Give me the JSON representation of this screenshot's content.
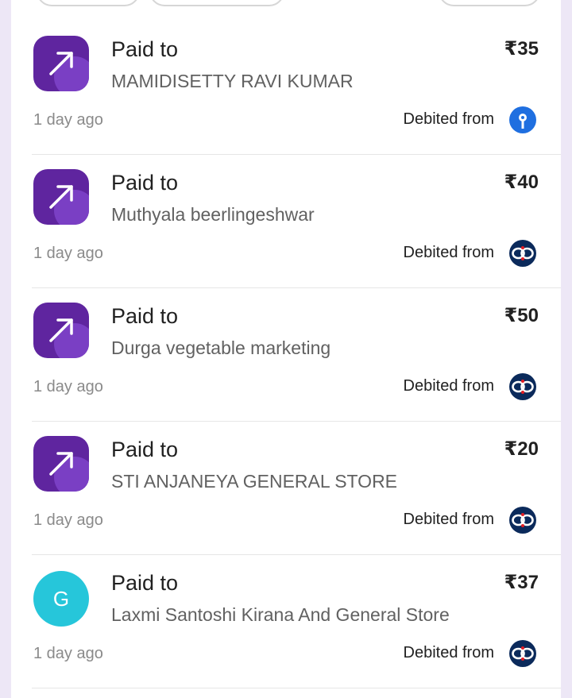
{
  "transactions": [
    {
      "type": "Paid to",
      "name": "MAMIDISETTY RAVI KUMAR",
      "amount": "₹35",
      "time": "1 day ago",
      "debited_label": "Debited from",
      "bank_icon": "sbi-bank-icon",
      "avatar": "arrow"
    },
    {
      "type": "Paid to",
      "name": "Muthyala beerlingeshwar",
      "amount": "₹40",
      "time": "1 day ago",
      "debited_label": "Debited from",
      "bank_icon": "kotak-bank-icon",
      "avatar": "arrow"
    },
    {
      "type": "Paid to",
      "name": "Durga vegetable marketing",
      "amount": "₹50",
      "time": "1 day ago",
      "debited_label": "Debited from",
      "bank_icon": "kotak-bank-icon",
      "avatar": "arrow"
    },
    {
      "type": "Paid to",
      "name": "STI ANJANEYA GENERAL STORE",
      "amount": "₹20",
      "time": "1 day ago",
      "debited_label": "Debited from",
      "bank_icon": "kotak-bank-icon",
      "avatar": "arrow"
    },
    {
      "type": "Paid to",
      "name": "Laxmi Santoshi Kirana And General Store",
      "amount": "₹37",
      "time": "1 day ago",
      "debited_label": "Debited from",
      "bank_icon": "kotak-bank-icon",
      "avatar": "letter",
      "avatar_letter": "G"
    }
  ],
  "colors": {
    "brand": "#5f259f",
    "avatar_letter_bg": "#26c6da",
    "sbi_blue": "#1f6fe0",
    "kotak_navy": "#0b2a5b",
    "kotak_red": "#e31e24"
  }
}
